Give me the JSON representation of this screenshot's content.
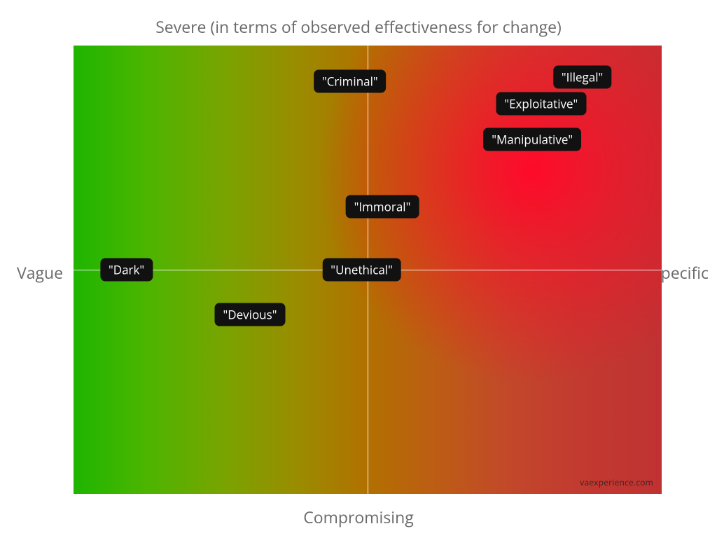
{
  "chart_data": {
    "type": "scatter",
    "title": "",
    "axes": {
      "top": "Severe (in terms of observed effectiveness for change)",
      "bottom": "Compromising",
      "left": "Vague",
      "right": "Specific",
      "xrange": [
        -1,
        1
      ],
      "yrange": [
        -1,
        1
      ]
    },
    "series": [
      {
        "name": "terms",
        "points": [
          {
            "label": "\"Dark\"",
            "x": -0.82,
            "y": 0.0
          },
          {
            "label": "\"Devious\"",
            "x": -0.4,
            "y": -0.2
          },
          {
            "label": "\"Unethical\"",
            "x": -0.02,
            "y": 0.0
          },
          {
            "label": "\"Immoral\"",
            "x": 0.05,
            "y": 0.28
          },
          {
            "label": "\"Criminal\"",
            "x": -0.06,
            "y": 0.84
          },
          {
            "label": "\"Manipulative\"",
            "x": 0.56,
            "y": 0.58
          },
          {
            "label": "\"Exploitative\"",
            "x": 0.59,
            "y": 0.74
          },
          {
            "label": "\"Illegal\"",
            "x": 0.73,
            "y": 0.86
          }
        ]
      }
    ]
  },
  "watermark": "vaexperience.com",
  "colors": {
    "gradient_left": "#1eb500",
    "gradient_right": "#c03232",
    "hotspot": "#ff0a2a",
    "chip_bg": "#111111",
    "chip_fg": "#ffffff",
    "axis_line": "#ffffff"
  }
}
